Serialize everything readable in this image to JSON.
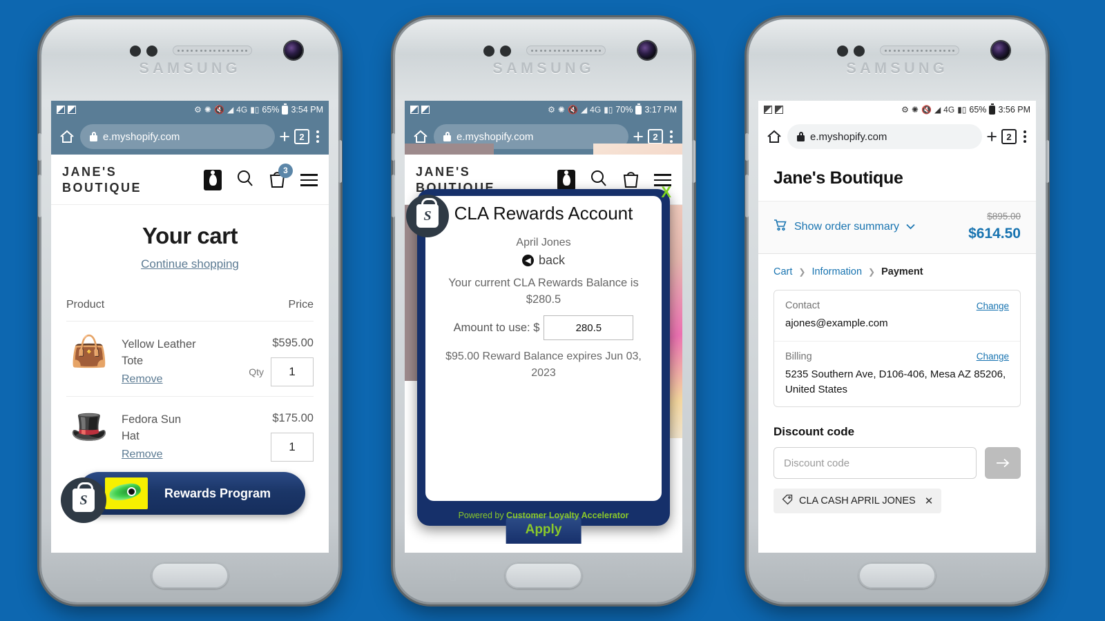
{
  "background_color": "#0d67b0",
  "phones": [
    {
      "device_brand": "SAMSUNG",
      "status": {
        "battery": "65%",
        "time": "3:54 PM",
        "network": "4G"
      },
      "browser": {
        "url": "e.myshopify.com",
        "tab_count": "2",
        "lock_icon": "lock-icon",
        "new_tab_icon": "plus-icon",
        "menu_icon": "kebab-menu-icon",
        "home_icon": "home-icon"
      },
      "store": {
        "logo_line1": "JANE'S",
        "logo_line2": "BOUTIQUE",
        "account_icon": "account-icon",
        "search_icon": "search-icon",
        "cart_icon": "shopping-bag-icon",
        "cart_badge": "3",
        "menu_icon": "hamburger-menu-icon"
      },
      "cart": {
        "title": "Your cart",
        "continue_link": "Continue shopping",
        "col_product": "Product",
        "col_price": "Price",
        "qty_label": "Qty",
        "remove_label": "Remove",
        "items": [
          {
            "name": "Yellow Leather Tote",
            "price": "$595.00",
            "qty": "1",
            "thumb_icon": "handbag-icon"
          },
          {
            "name": "Fedora Sun Hat",
            "price": "$175.00",
            "qty": "1",
            "thumb_icon": "hat-icon"
          }
        ]
      },
      "rewards_pill": {
        "label": "Rewards Program",
        "logo_icon": "cla-logo-icon",
        "shopify_icon": "shopify-bag-icon"
      }
    },
    {
      "device_brand": "SAMSUNG",
      "status": {
        "battery": "70%",
        "time": "3:17 PM",
        "network": "4G"
      },
      "browser": {
        "url": "e.myshopify.com",
        "tab_count": "2",
        "lock_icon": "lock-icon",
        "new_tab_icon": "plus-icon",
        "menu_icon": "kebab-menu-icon",
        "home_icon": "home-icon"
      },
      "store": {
        "logo_line1": "JANE'S",
        "logo_line2": "BOUTIQUE",
        "account_icon": "account-icon",
        "search_icon": "search-icon",
        "cart_icon": "shopping-bag-icon",
        "menu_icon": "hamburger-menu-icon"
      },
      "modal": {
        "title": "CLA Rewards Account",
        "close_label": "X",
        "customer_name": "April Jones",
        "back_label": "back",
        "balance_text": "Your current CLA Rewards Balance is $280.5",
        "amount_label": "Amount to use: $",
        "amount_value": "280.5",
        "expiry_text": "$95.00 Reward Balance expires Jun 03, 2023",
        "apply_label": "Apply",
        "powered_prefix": "Powered by ",
        "powered_brand": "Customer Loyalty Accelerator",
        "shopify_icon": "shopify-bag-icon",
        "accent_green": "#8bc92a",
        "frame_navy": "#16306a"
      }
    },
    {
      "device_brand": "SAMSUNG",
      "status": {
        "battery": "65%",
        "time": "3:56 PM",
        "network": "4G"
      },
      "browser": {
        "url": "e.myshopify.com",
        "tab_count": "2",
        "lock_icon": "lock-icon",
        "new_tab_icon": "plus-icon",
        "menu_icon": "kebab-menu-icon",
        "home_icon": "home-icon"
      },
      "checkout": {
        "shop_title": "Jane's Boutique",
        "summary_link": "Show order summary",
        "summary_icon": "cart-icon",
        "chevron_icon": "chevron-down-icon",
        "original_total": "$895.00",
        "total": "$614.50",
        "breadcrumbs": [
          {
            "label": "Cart",
            "current": false
          },
          {
            "label": "Information",
            "current": false
          },
          {
            "label": "Payment",
            "current": true
          }
        ],
        "contact_label": "Contact",
        "contact_value": "ajones@example.com",
        "contact_change": "Change",
        "billing_label": "Billing",
        "billing_value": "5235 Southern Ave, D106-406, Mesa AZ 85206, United States",
        "billing_change": "Change",
        "discount_heading": "Discount code",
        "discount_placeholder": "Discount code",
        "discount_value": "",
        "discount_submit_icon": "arrow-right-icon",
        "applied_chip": "CLA CASH APRIL JONES",
        "chip_tag_icon": "tag-icon",
        "chip_remove_icon": "close-icon",
        "accent_blue": "#1773b0"
      }
    }
  ]
}
